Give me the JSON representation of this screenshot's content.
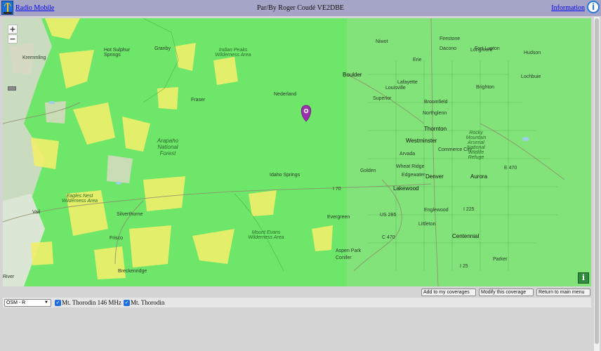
{
  "header": {
    "app_name": "Radio Mobile",
    "credit": "Par/By Roger Coudé VE2DBE",
    "info_link": "Information",
    "info_icon": "info-icon",
    "logo_icon": "radio-tower-icon"
  },
  "map": {
    "zoom_in": "+",
    "zoom_out": "−",
    "info_button": "i",
    "marker_icon": "transmitter-marker-icon",
    "labels": [
      "Boulder",
      "Lafayette",
      "Erie",
      "Louisville",
      "Broomfield",
      "Northglenn",
      "Thornton",
      "Westminster",
      "Arvada",
      "Wheat Ridge",
      "Denver",
      "Aurora",
      "Lakewood",
      "Englewood",
      "Littleton",
      "Centennial",
      "Parker",
      "Evergreen",
      "Nederland",
      "Fraser",
      "Granby",
      "Idaho Springs",
      "Arapaho National Forest",
      "Mount Evans Wilderness Area",
      "Silverthorne",
      "Frisco",
      "Breckenridge",
      "Kremmling",
      "Hot Sulphur Springs",
      "Eagles Nest Wilderness Area",
      "Longmont",
      "Firestone",
      "Dacono",
      "Fort Lupton",
      "Hudson",
      "Brighton",
      "Lochbuie",
      "Superior",
      "Commerce City",
      "Edgewater",
      "Golden",
      "Aspen Park",
      "Conifer",
      "Niwot",
      "Rocky Mountain Arsenal National Wildlife Refuge",
      "Indian Peaks Wilderness Area",
      "Vail",
      "River",
      "I 70",
      "E 470",
      "US 285",
      "I 225",
      "C 470",
      "I 25"
    ]
  },
  "actions": {
    "add": "Add to my coverages",
    "modify": "Modify this coverage",
    "return": "Return to main menu"
  },
  "controls": {
    "basemap_value": "OSM - R",
    "coverage_1": "Mt. Thorodin 146 MHz",
    "coverage_2": "Mt. Thorodin",
    "coverage_1_checked": true,
    "coverage_2_checked": true
  },
  "colors": {
    "header_bg": "#a5a5c8",
    "coverage_green": "#6ee66a",
    "weak_yellow": "#f2f06a",
    "marker_purple": "#9b2fae",
    "accent_blue": "#1f6fe0"
  }
}
